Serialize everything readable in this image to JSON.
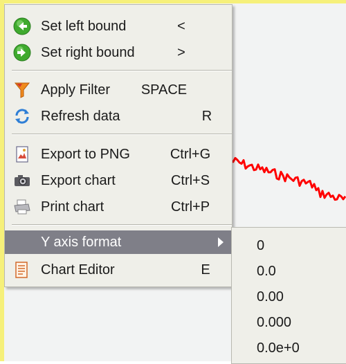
{
  "menu": {
    "items": [
      {
        "label": "Set left bound",
        "shortcut": "<",
        "icon": "arrow-left-green-icon"
      },
      {
        "label": "Set right bound",
        "shortcut": ">",
        "icon": "arrow-right-green-icon"
      },
      {
        "label": "Apply Filter",
        "shortcut": "SPACE",
        "icon": "filter-icon"
      },
      {
        "label": "Refresh data",
        "shortcut": "R",
        "icon": "refresh-icon"
      },
      {
        "label": "Export to PNG",
        "shortcut": "Ctrl+G",
        "icon": "image-file-icon"
      },
      {
        "label": "Export chart",
        "shortcut": "Ctrl+S",
        "icon": "camera-icon"
      },
      {
        "label": "Print chart",
        "shortcut": "Ctrl+P",
        "icon": "printer-icon"
      },
      {
        "label": "Y axis format",
        "shortcut": "",
        "icon": ""
      },
      {
        "label": "Chart Editor",
        "shortcut": "E",
        "icon": "chart-editor-icon"
      }
    ]
  },
  "submenu": {
    "items": [
      "0",
      "0.0",
      "0.00",
      "0.000",
      "0.0e+0"
    ]
  },
  "colors": {
    "signal": "#ff0000",
    "selected_bg": "#7f7f88",
    "menu_bg": "#efefe9",
    "chart_border": "#f6f07a"
  }
}
